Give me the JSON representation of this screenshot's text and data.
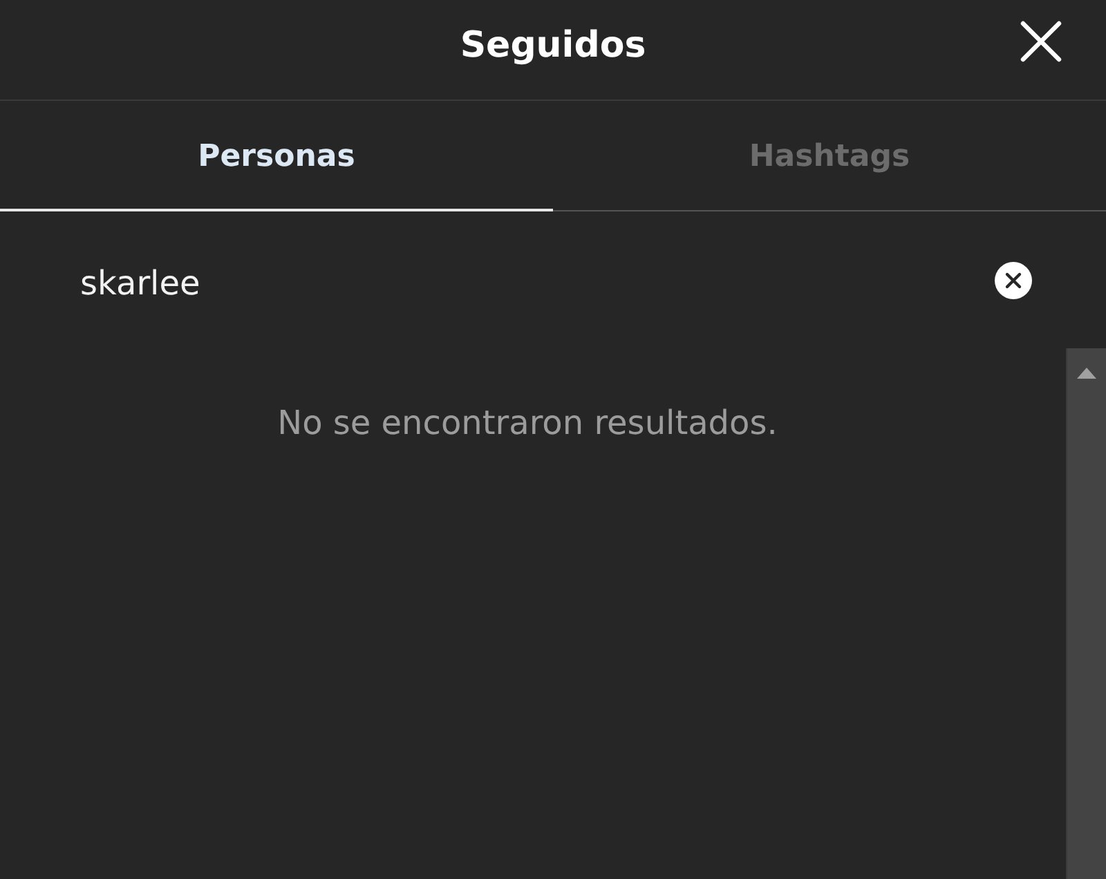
{
  "header": {
    "title": "Seguidos"
  },
  "tabs": [
    {
      "label": "Personas",
      "selected": true
    },
    {
      "label": "Hashtags",
      "selected": false
    }
  ],
  "search": {
    "value": "skarlee"
  },
  "empty_message": "No se encontraron resultados."
}
